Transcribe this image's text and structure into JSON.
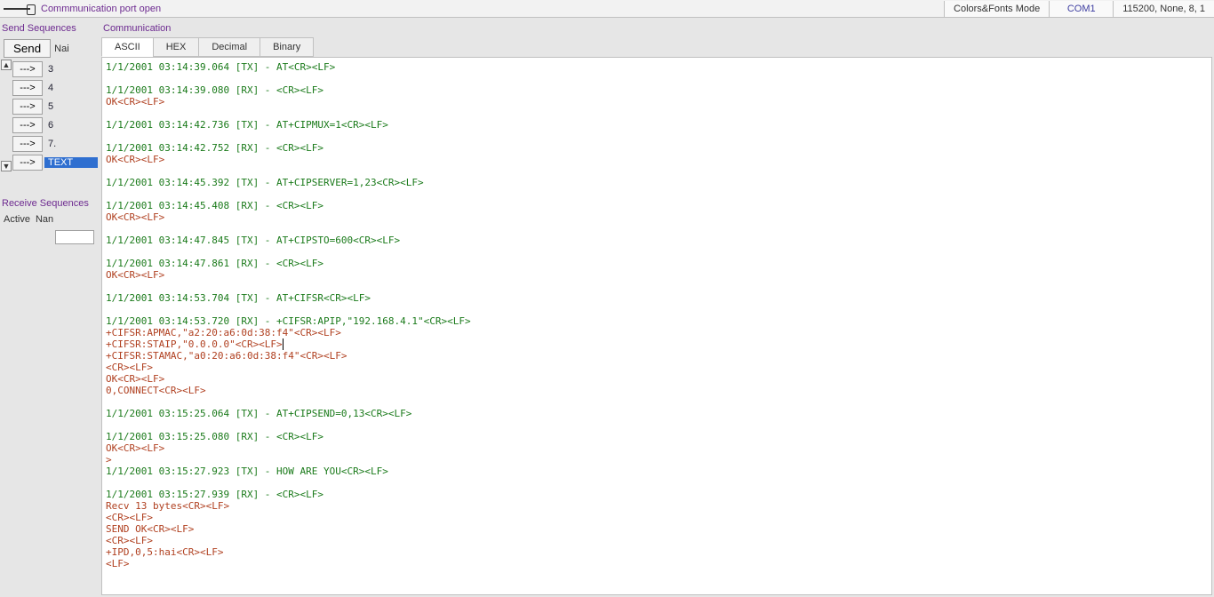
{
  "status": {
    "message": "Commmunication port open",
    "mode_label": "Colors&Fonts Mode",
    "port": "COM1",
    "config": "115200, None, 8, 1"
  },
  "send_sequences": {
    "header": "Send Sequences",
    "send_btn": "Send",
    "name_col": "Nai",
    "arrow_label": "--->",
    "rows": [
      {
        "name": "3",
        "selected": false
      },
      {
        "name": "4",
        "selected": false
      },
      {
        "name": "5",
        "selected": false
      },
      {
        "name": "6",
        "selected": false
      },
      {
        "name": "7.",
        "selected": false
      },
      {
        "name": "TEXT",
        "selected": true
      }
    ]
  },
  "receive_sequences": {
    "header": "Receive Sequences",
    "active_label": "Active",
    "name_col": "Nan"
  },
  "communication": {
    "header": "Communication",
    "tabs": [
      {
        "label": "ASCII",
        "active": true
      },
      {
        "label": "HEX",
        "active": false
      },
      {
        "label": "Decimal",
        "active": false
      },
      {
        "label": "Binary",
        "active": false
      }
    ],
    "lines": [
      {
        "cls": "tx",
        "text": "1/1/2001 03:14:39.064 [TX] - AT<CR><LF>"
      },
      {
        "cls": "",
        "text": ""
      },
      {
        "cls": "rx",
        "text": "1/1/2001 03:14:39.080 [RX] - <CR><LF>"
      },
      {
        "cls": "ok",
        "text": "OK<CR><LF>"
      },
      {
        "cls": "",
        "text": ""
      },
      {
        "cls": "tx",
        "text": "1/1/2001 03:14:42.736 [TX] - AT+CIPMUX=1<CR><LF>"
      },
      {
        "cls": "",
        "text": ""
      },
      {
        "cls": "rx",
        "text": "1/1/2001 03:14:42.752 [RX] - <CR><LF>"
      },
      {
        "cls": "ok",
        "text": "OK<CR><LF>"
      },
      {
        "cls": "",
        "text": ""
      },
      {
        "cls": "tx",
        "text": "1/1/2001 03:14:45.392 [TX] - AT+CIPSERVER=1,23<CR><LF>"
      },
      {
        "cls": "",
        "text": ""
      },
      {
        "cls": "rx",
        "text": "1/1/2001 03:14:45.408 [RX] - <CR><LF>"
      },
      {
        "cls": "ok",
        "text": "OK<CR><LF>"
      },
      {
        "cls": "",
        "text": ""
      },
      {
        "cls": "tx",
        "text": "1/1/2001 03:14:47.845 [TX] - AT+CIPSTO=600<CR><LF>"
      },
      {
        "cls": "",
        "text": ""
      },
      {
        "cls": "rx",
        "text": "1/1/2001 03:14:47.861 [RX] - <CR><LF>"
      },
      {
        "cls": "ok",
        "text": "OK<CR><LF>"
      },
      {
        "cls": "",
        "text": ""
      },
      {
        "cls": "tx",
        "text": "1/1/2001 03:14:53.704 [TX] - AT+CIFSR<CR><LF>"
      },
      {
        "cls": "",
        "text": ""
      },
      {
        "cls": "rx",
        "text": "1/1/2001 03:14:53.720 [RX] - +CIFSR:APIP,\"192.168.4.1\"<CR><LF>"
      },
      {
        "cls": "data",
        "text": "+CIFSR:APMAC,\"a2:20:a6:0d:38:f4\"<CR><LF>"
      },
      {
        "cls": "data",
        "text": "+CIFSR:STAIP,\"0.0.0.0\"<CR><LF>",
        "cursor": true
      },
      {
        "cls": "data",
        "text": "+CIFSR:STAMAC,\"a0:20:a6:0d:38:f4\"<CR><LF>"
      },
      {
        "cls": "data",
        "text": "<CR><LF>"
      },
      {
        "cls": "ok",
        "text": "OK<CR><LF>"
      },
      {
        "cls": "data",
        "text": "0,CONNECT<CR><LF>"
      },
      {
        "cls": "",
        "text": ""
      },
      {
        "cls": "tx",
        "text": "1/1/2001 03:15:25.064 [TX] - AT+CIPSEND=0,13<CR><LF>"
      },
      {
        "cls": "",
        "text": ""
      },
      {
        "cls": "rx",
        "text": "1/1/2001 03:15:25.080 [RX] - <CR><LF>"
      },
      {
        "cls": "ok",
        "text": "OK<CR><LF>"
      },
      {
        "cls": "data",
        "text": ">"
      },
      {
        "cls": "tx",
        "text": "1/1/2001 03:15:27.923 [TX] - HOW ARE YOU<CR><LF>"
      },
      {
        "cls": "",
        "text": ""
      },
      {
        "cls": "rx",
        "text": "1/1/2001 03:15:27.939 [RX] - <CR><LF>"
      },
      {
        "cls": "data",
        "text": "Recv 13 bytes<CR><LF>"
      },
      {
        "cls": "data",
        "text": "<CR><LF>"
      },
      {
        "cls": "data",
        "text": "SEND OK<CR><LF>"
      },
      {
        "cls": "data",
        "text": "<CR><LF>"
      },
      {
        "cls": "data",
        "text": "+IPD,0,5:hai<CR><LF>"
      },
      {
        "cls": "data",
        "text": "<LF>"
      }
    ]
  }
}
